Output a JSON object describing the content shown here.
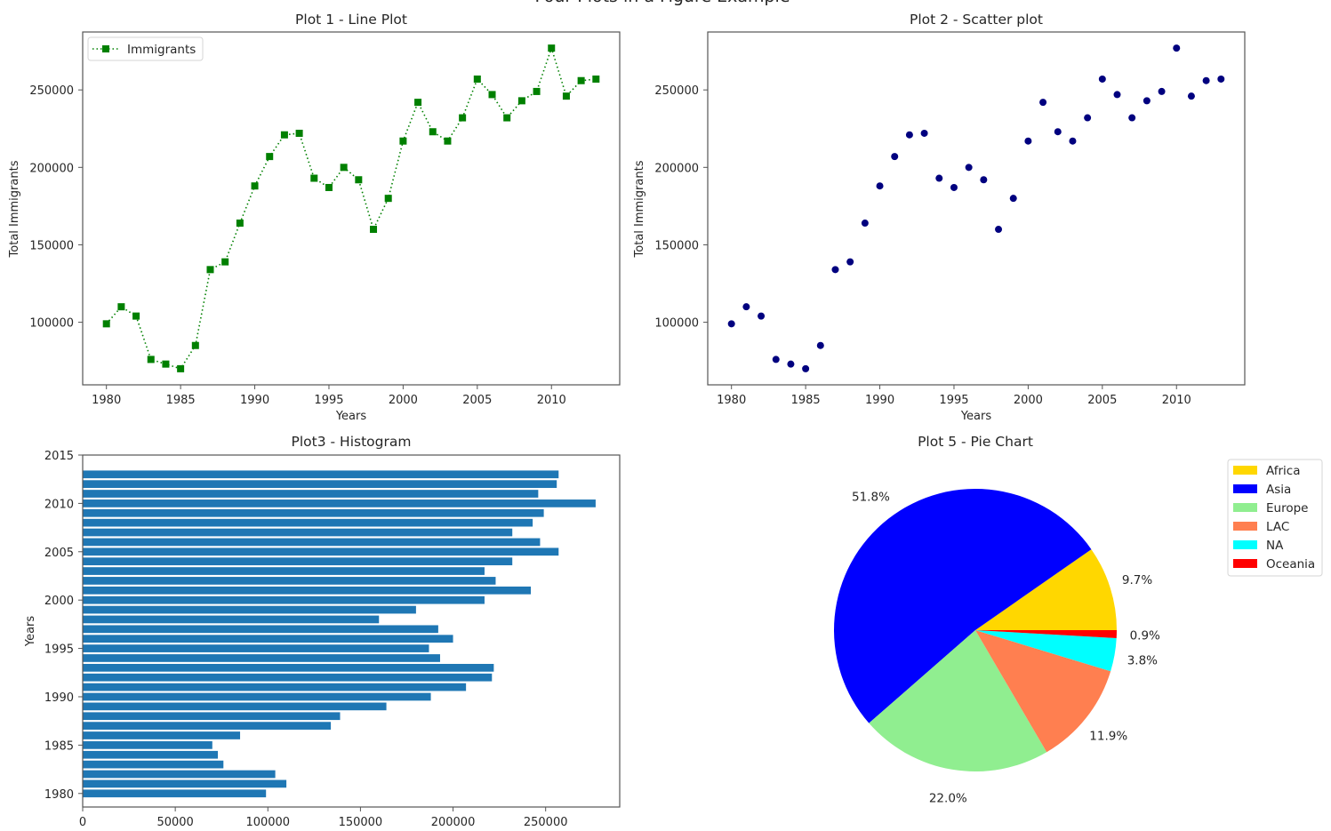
{
  "figure": {
    "title": "Four Plots in a Figure Example"
  },
  "chart_data": [
    {
      "type": "line",
      "title": "Plot 1 - Line Plot",
      "xlabel": "Years",
      "ylabel": "Total Immigrants",
      "xlim": [
        1978.4,
        2014.6
      ],
      "ylim": [
        59600,
        287400
      ],
      "xticks": [
        "1980",
        "1985",
        "1990",
        "1995",
        "2000",
        "2005",
        "2010"
      ],
      "yticks": [
        "100000",
        "150000",
        "200000",
        "250000"
      ],
      "legend": {
        "position": "upper-left",
        "entries": [
          "Immigrants"
        ]
      },
      "line_style": "dotted",
      "marker": "square",
      "color": "#008000",
      "x": [
        1980,
        1981,
        1982,
        1983,
        1984,
        1985,
        1986,
        1987,
        1988,
        1989,
        1990,
        1991,
        1992,
        1993,
        1994,
        1995,
        1996,
        1997,
        1998,
        1999,
        2000,
        2001,
        2002,
        2003,
        2004,
        2005,
        2006,
        2007,
        2008,
        2009,
        2010,
        2011,
        2012,
        2013
      ],
      "series": [
        {
          "name": "Immigrants",
          "values": [
            99000,
            110000,
            104000,
            76000,
            73000,
            70000,
            85000,
            134000,
            139000,
            164000,
            188000,
            207000,
            221000,
            222000,
            193000,
            187000,
            200000,
            192000,
            160000,
            180000,
            217000,
            242000,
            223000,
            217000,
            232000,
            257000,
            247000,
            232000,
            243000,
            249000,
            277000,
            246000,
            256000,
            257000
          ]
        }
      ]
    },
    {
      "type": "scatter",
      "title": "Plot 2 - Scatter plot",
      "xlabel": "Years",
      "ylabel": "Total Immigrants",
      "xlim": [
        1978.4,
        2014.6
      ],
      "ylim": [
        59600,
        287400
      ],
      "xticks": [
        "1980",
        "1985",
        "1990",
        "1995",
        "2000",
        "2005",
        "2010"
      ],
      "yticks": [
        "100000",
        "150000",
        "200000",
        "250000"
      ],
      "color": "#00007f",
      "x": [
        1980,
        1981,
        1982,
        1983,
        1984,
        1985,
        1986,
        1987,
        1988,
        1989,
        1990,
        1991,
        1992,
        1993,
        1994,
        1995,
        1996,
        1997,
        1998,
        1999,
        2000,
        2001,
        2002,
        2003,
        2004,
        2005,
        2006,
        2007,
        2008,
        2009,
        2010,
        2011,
        2012,
        2013
      ],
      "series": [
        {
          "name": "Total Immigrants",
          "values": [
            99000,
            110000,
            104000,
            76000,
            73000,
            70000,
            85000,
            134000,
            139000,
            164000,
            188000,
            207000,
            221000,
            222000,
            193000,
            187000,
            200000,
            192000,
            160000,
            180000,
            217000,
            242000,
            223000,
            217000,
            232000,
            257000,
            247000,
            232000,
            243000,
            249000,
            277000,
            246000,
            256000,
            257000
          ]
        }
      ]
    },
    {
      "type": "bar",
      "orientation": "horizontal",
      "title": "Plot3 - Histogram",
      "xlabel": "",
      "ylabel": "Years",
      "xlim": [
        0,
        290000
      ],
      "ylim": [
        1978.6,
        2015
      ],
      "xticks": [
        "0",
        "50000",
        "100000",
        "150000",
        "200000",
        "250000"
      ],
      "yticks": [
        "1980",
        "1985",
        "1990",
        "1995",
        "2000",
        "2005",
        "2010",
        "2015"
      ],
      "color": "#1f77b4",
      "categories": [
        1980,
        1981,
        1982,
        1983,
        1984,
        1985,
        1986,
        1987,
        1988,
        1989,
        1990,
        1991,
        1992,
        1993,
        1994,
        1995,
        1996,
        1997,
        1998,
        1999,
        2000,
        2001,
        2002,
        2003,
        2004,
        2005,
        2006,
        2007,
        2008,
        2009,
        2010,
        2011,
        2012,
        2013
      ],
      "values": [
        99000,
        110000,
        104000,
        76000,
        73000,
        70000,
        85000,
        134000,
        139000,
        164000,
        188000,
        207000,
        221000,
        222000,
        193000,
        187000,
        200000,
        192000,
        160000,
        180000,
        217000,
        242000,
        223000,
        217000,
        232000,
        257000,
        247000,
        232000,
        243000,
        249000,
        277000,
        246000,
        256000,
        257000
      ]
    },
    {
      "type": "pie",
      "title": "Plot 5 - Pie Chart",
      "legend": {
        "position": "upper-right"
      },
      "slices": [
        {
          "label": "Africa",
          "value": 9.7,
          "pct_label": "9.7%",
          "color": "#ffd700"
        },
        {
          "label": "Asia",
          "value": 51.8,
          "pct_label": "51.8%",
          "color": "#0000ff"
        },
        {
          "label": "Europe",
          "value": 22.0,
          "pct_label": "22.0%",
          "color": "#90ee90"
        },
        {
          "label": "LAC",
          "value": 11.9,
          "pct_label": "11.9%",
          "color": "#ff7f50"
        },
        {
          "label": "NA",
          "value": 3.8,
          "pct_label": "3.8%",
          "color": "#00ffff"
        },
        {
          "label": "Oceania",
          "value": 0.9,
          "pct_label": "0.9%",
          "color": "#ff0000"
        }
      ]
    }
  ]
}
